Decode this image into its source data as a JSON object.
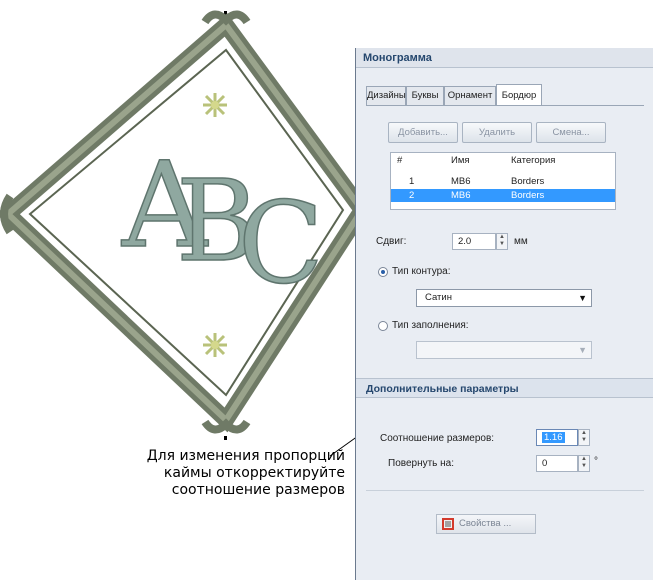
{
  "panel": {
    "title": "Монограмма",
    "tabs": [
      {
        "label": "Дизайны",
        "active": false
      },
      {
        "label": "Буквы",
        "active": false
      },
      {
        "label": "Орнамент",
        "active": false
      },
      {
        "label": "Бордюр",
        "active": true
      }
    ],
    "buttons": {
      "add": "Добавить...",
      "delete": "Удалить",
      "change": "Смена..."
    },
    "grid": {
      "columns": [
        "#",
        "Имя",
        "Категория"
      ],
      "rows": [
        {
          "num": "1",
          "name": "MB6",
          "category": "Borders",
          "selected": false
        },
        {
          "num": "2",
          "name": "MB6",
          "category": "Borders",
          "selected": true
        }
      ]
    },
    "offset": {
      "label": "Сдвиг:",
      "value": "2.0",
      "unit": "мм"
    },
    "outline_type": {
      "label": "Тип контура:",
      "selected": true,
      "value": "Сатин"
    },
    "fill_type": {
      "label": "Тип заполнения:",
      "selected": false,
      "value": ""
    },
    "advanced": {
      "title": "Дополнительные параметры",
      "aspect_ratio": {
        "label": "Соотношение размеров:",
        "value": "1.16"
      },
      "rotate": {
        "label": "Повернуть на:",
        "value": "0",
        "unit": "°"
      }
    },
    "properties_button": "Свойства ..."
  },
  "callout": {
    "lines": [
      "Для изменения пропорций",
      "каймы откорректируйте",
      "соотношение размеров"
    ]
  },
  "artwork": {
    "letters": "ABC"
  },
  "colors": {
    "border_thread": "#7b8574",
    "letter_thread": "#8fa8a0",
    "star_thread": "#b9c27a",
    "selection": "#3399ff",
    "panel_header": "#25476e"
  }
}
